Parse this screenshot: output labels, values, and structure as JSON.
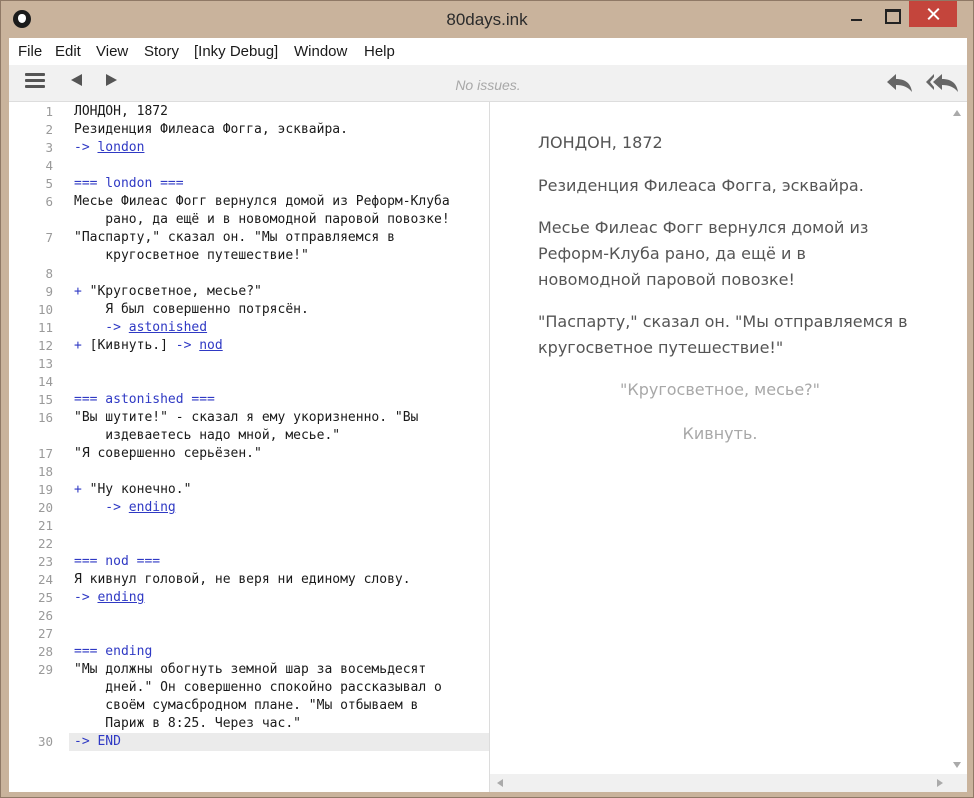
{
  "window": {
    "title": "80days.ink"
  },
  "menu": [
    "File",
    "Edit",
    "View",
    "Story",
    "[Inky Debug]",
    "Window",
    "Help"
  ],
  "toolbar": {
    "status": "No issues."
  },
  "editor": {
    "lines": [
      {
        "n": "1",
        "parts": [
          {
            "t": "ЛОНДОН, 1872",
            "c": ""
          }
        ]
      },
      {
        "n": "2",
        "parts": [
          {
            "t": "Резиденция Филеаса Фогга, эсквайра.",
            "c": ""
          }
        ]
      },
      {
        "n": "3",
        "parts": [
          {
            "t": "-> ",
            "c": "kw"
          },
          {
            "t": "london",
            "c": "lnk"
          }
        ]
      },
      {
        "n": "4",
        "parts": []
      },
      {
        "n": "5",
        "parts": [
          {
            "t": "=== london ===",
            "c": "kw"
          }
        ]
      },
      {
        "n": "6",
        "parts": [
          {
            "t": "Месье Филеас Фогг вернулся домой из Реформ-Клуба",
            "c": ""
          }
        ]
      },
      {
        "n": "",
        "parts": [
          {
            "t": "    рано, да ещё и в новомодной паровой повозке!",
            "c": ""
          }
        ]
      },
      {
        "n": "7",
        "parts": [
          {
            "t": "\"Паспарту,\" сказал он. \"Мы отправляемся в",
            "c": ""
          }
        ]
      },
      {
        "n": "",
        "parts": [
          {
            "t": "    кругосветное путешествие!\"",
            "c": ""
          }
        ]
      },
      {
        "n": "8",
        "parts": []
      },
      {
        "n": "9",
        "parts": [
          {
            "t": "+ ",
            "c": "kw"
          },
          {
            "t": "\"Кругосветное, месье?\"",
            "c": ""
          }
        ]
      },
      {
        "n": "10",
        "parts": [
          {
            "t": "    Я был совершенно потрясён.",
            "c": ""
          }
        ]
      },
      {
        "n": "11",
        "parts": [
          {
            "t": "    -> ",
            "c": "kw"
          },
          {
            "t": "astonished",
            "c": "lnk"
          }
        ]
      },
      {
        "n": "12",
        "parts": [
          {
            "t": "+ ",
            "c": "kw"
          },
          {
            "t": "[Кивнуть.] ",
            "c": ""
          },
          {
            "t": "-> ",
            "c": "kw"
          },
          {
            "t": "nod",
            "c": "lnk"
          }
        ]
      },
      {
        "n": "13",
        "parts": []
      },
      {
        "n": "14",
        "parts": []
      },
      {
        "n": "15",
        "parts": [
          {
            "t": "=== astonished ===",
            "c": "kw"
          }
        ]
      },
      {
        "n": "16",
        "parts": [
          {
            "t": "\"Вы шутите!\" - сказал я ему укоризненно. \"Вы",
            "c": ""
          }
        ]
      },
      {
        "n": "",
        "parts": [
          {
            "t": "    издеваетесь надо мной, месье.\"",
            "c": ""
          }
        ]
      },
      {
        "n": "17",
        "parts": [
          {
            "t": "\"Я совершенно серьёзен.\"",
            "c": ""
          }
        ]
      },
      {
        "n": "18",
        "parts": []
      },
      {
        "n": "19",
        "parts": [
          {
            "t": "+ ",
            "c": "kw"
          },
          {
            "t": "\"Ну конечно.\"",
            "c": ""
          }
        ]
      },
      {
        "n": "20",
        "parts": [
          {
            "t": "    -> ",
            "c": "kw"
          },
          {
            "t": "ending",
            "c": "lnk"
          }
        ]
      },
      {
        "n": "21",
        "parts": []
      },
      {
        "n": "22",
        "parts": []
      },
      {
        "n": "23",
        "parts": [
          {
            "t": "=== nod ===",
            "c": "kw"
          }
        ]
      },
      {
        "n": "24",
        "parts": [
          {
            "t": "Я кивнул головой, не веря ни единому слову.",
            "c": ""
          }
        ]
      },
      {
        "n": "25",
        "parts": [
          {
            "t": "-> ",
            "c": "kw"
          },
          {
            "t": "ending",
            "c": "lnk"
          }
        ]
      },
      {
        "n": "26",
        "parts": []
      },
      {
        "n": "27",
        "parts": []
      },
      {
        "n": "28",
        "parts": [
          {
            "t": "=== ending",
            "c": "kw"
          }
        ]
      },
      {
        "n": "29",
        "parts": [
          {
            "t": "\"Мы должны обогнуть земной шар за восемьдесят",
            "c": ""
          }
        ]
      },
      {
        "n": "",
        "parts": [
          {
            "t": "    дней.\" Он совершенно спокойно рассказывал о",
            "c": ""
          }
        ]
      },
      {
        "n": "",
        "parts": [
          {
            "t": "    своём сумасбродном плане. \"Мы отбываем в",
            "c": ""
          }
        ]
      },
      {
        "n": "",
        "parts": [
          {
            "t": "    Париж в 8:25. Через час.\"",
            "c": ""
          }
        ]
      },
      {
        "n": "30",
        "parts": [
          {
            "t": "-> END",
            "c": "kw"
          }
        ],
        "current": true
      }
    ]
  },
  "player": {
    "paragraphs": [
      "ЛОНДОН, 1872",
      "Резиденция Филеаса Фогга, эсквайра.",
      "Месье Филеас Фогг вернулся домой из Реформ-Клуба рано, да ещё и в новомодной паровой повозке!",
      "\"Паспарту,\" сказал он. \"Мы отправляемся в кругосветное путешествие!\""
    ],
    "choices": [
      "\"Кругосветное, месье?\"",
      "Кивнуть."
    ]
  },
  "colors": {
    "keyword": "#2f39c4",
    "choice": "#a8a8a8",
    "story_text": "#555555"
  },
  "icons": {
    "app": "ink-app-icon",
    "toggle": "hamburger-icon",
    "back": "arrow-left-icon",
    "forward": "arrow-right-icon",
    "rewind": "rewind-icon",
    "rewind_all": "rewind-all-icon"
  }
}
